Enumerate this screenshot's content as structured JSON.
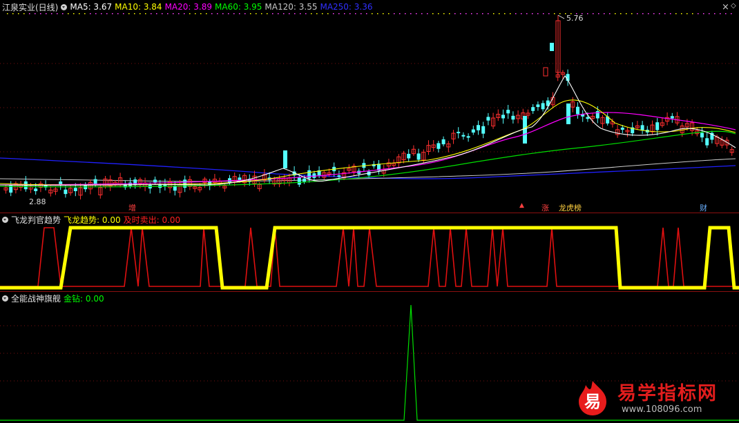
{
  "main": {
    "stock_name": "江泉实业(日线)",
    "ma_items": [
      {
        "label": "MA5: 3.67",
        "color": "#ffffff"
      },
      {
        "label": "MA10: 3.84",
        "color": "#ffff00"
      },
      {
        "label": "MA20: 3.89",
        "color": "#ff00ff"
      },
      {
        "label": "MA60: 3.95",
        "color": "#00ff00"
      },
      {
        "label": "MA120: 3.55",
        "color": "#c8c8c8"
      },
      {
        "label": "MA250: 3.36",
        "color": "#2020ff"
      }
    ],
    "high_label": "5.76",
    "low_label": "2.88",
    "markers": {
      "zeng": "增",
      "zhang": "涨",
      "longhu": "龙虎榜",
      "cai": "财"
    },
    "close_icon": "close-x-icon",
    "restore_icon": "diamond-icon"
  },
  "indicator1": {
    "name": "飞龙判官趋势",
    "items": [
      {
        "label": "飞龙趋势: 0.00",
        "color": "#ffff00"
      },
      {
        "label": "及时卖出: 0.00",
        "color": "#ff2020"
      }
    ],
    "yellow_segments": [
      [
        0,
        417
      ],
      [
        88,
        417
      ],
      [
        102,
        330
      ],
      [
        313,
        330
      ],
      [
        322,
        417
      ],
      [
        386,
        417
      ],
      [
        398,
        330
      ],
      [
        892,
        330
      ],
      [
        898,
        417
      ],
      [
        1020,
        417
      ],
      [
        1028,
        330
      ],
      [
        1055,
        330
      ],
      [
        1063,
        417
      ],
      [
        1070,
        417
      ]
    ],
    "red_segments": [
      [
        0,
        415
      ],
      [
        55,
        415
      ],
      [
        64,
        330
      ],
      [
        78,
        330
      ],
      [
        88,
        415
      ],
      [
        180,
        415
      ],
      [
        190,
        330
      ],
      [
        200,
        415
      ],
      [
        206,
        330
      ],
      [
        216,
        415
      ],
      [
        290,
        415
      ],
      [
        295,
        330
      ],
      [
        303,
        415
      ],
      [
        355,
        415
      ],
      [
        363,
        330
      ],
      [
        372,
        415
      ],
      [
        392,
        415
      ],
      [
        398,
        330
      ],
      [
        405,
        415
      ],
      [
        487,
        415
      ],
      [
        497,
        330
      ],
      [
        505,
        415
      ],
      [
        512,
        330
      ],
      [
        518,
        415
      ],
      [
        527,
        415
      ],
      [
        535,
        330
      ],
      [
        545,
        415
      ],
      [
        620,
        415
      ],
      [
        628,
        330
      ],
      [
        636,
        415
      ],
      [
        645,
        415
      ],
      [
        652,
        330
      ],
      [
        660,
        415
      ],
      [
        668,
        415
      ],
      [
        675,
        330
      ],
      [
        683,
        415
      ],
      [
        706,
        415
      ],
      [
        713,
        330
      ],
      [
        720,
        415
      ],
      [
        728,
        330
      ],
      [
        735,
        415
      ],
      [
        792,
        415
      ],
      [
        799,
        330
      ],
      [
        806,
        415
      ],
      [
        952,
        415
      ],
      [
        960,
        330
      ],
      [
        968,
        415
      ],
      [
        975,
        415
      ],
      [
        982,
        330
      ],
      [
        990,
        415
      ],
      [
        1070,
        415
      ]
    ]
  },
  "indicator2": {
    "name": "全能战神旗舰",
    "items": [
      {
        "label": "金钻: 0.00",
        "color": "#00ff00"
      }
    ]
  },
  "watermark": {
    "logo_char": "易",
    "title": "易学指标网",
    "url": "www.108096.com"
  },
  "colors": {
    "background": "#000000",
    "separator": "#8b1010",
    "up": "#ff3030",
    "down": "#54ffff"
  }
}
